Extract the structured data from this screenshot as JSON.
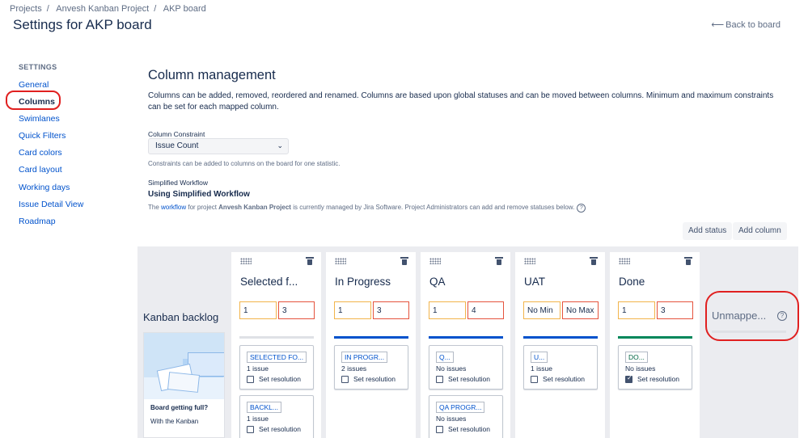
{
  "breadcrumbs": [
    "Projects",
    "Anvesh Kanban Project",
    "AKP board"
  ],
  "page_title": "Settings for AKP board",
  "back_link": "Back to board",
  "sidebar": {
    "heading": "SETTINGS",
    "items": [
      {
        "label": "General"
      },
      {
        "label": "Columns",
        "active": true
      },
      {
        "label": "Swimlanes"
      },
      {
        "label": "Quick Filters"
      },
      {
        "label": "Card colors"
      },
      {
        "label": "Card layout"
      },
      {
        "label": "Working days"
      },
      {
        "label": "Issue Detail View"
      },
      {
        "label": "Roadmap"
      }
    ]
  },
  "main": {
    "title": "Column management",
    "description": "Columns can be added, removed, reordered and renamed. Columns are based upon global statuses and can be moved between columns. Minimum and maximum constraints can be set for each mapped column.",
    "constraint_label": "Column Constraint",
    "constraint_value": "Issue Count",
    "constraint_hint": "Constraints can be added to columns on the board for one statistic.",
    "workflow_label": "Simplified Workflow",
    "workflow_title": "Using Simplified Workflow",
    "workflow_desc_pre": "The ",
    "workflow_link": "workflow",
    "workflow_desc_mid": " for project ",
    "workflow_project": "Anvesh Kanban Project",
    "workflow_desc_post": " is currently managed by Jira Software. Project Administrators can add and remove statuses below.",
    "add_status": "Add status",
    "add_column": "Add column"
  },
  "board": {
    "backlog_title": "Kanban backlog",
    "backlog_card_title": "Board getting full?",
    "backlog_card_body": "With the Kanban",
    "columns": [
      {
        "name": "Selected f...",
        "min": "1",
        "max": "3",
        "bar_color": "#dfe1e6",
        "statuses": [
          {
            "label": "SELECTED FO...",
            "count": "1 issue",
            "resolution": "Set resolution",
            "checked": false
          },
          {
            "label": "BACKL...",
            "count": "1 issue",
            "resolution": "Set resolution",
            "checked": false
          }
        ]
      },
      {
        "name": "In Progress",
        "min": "1",
        "max": "3",
        "bar_color": "#0052cc",
        "statuses": [
          {
            "label": "IN PROGR...",
            "count": "2 issues",
            "resolution": "Set resolution",
            "checked": false
          }
        ]
      },
      {
        "name": "QA",
        "min": "1",
        "max": "4",
        "bar_color": "#0052cc",
        "statuses": [
          {
            "label": "Q...",
            "count": "No issues",
            "resolution": "Set resolution",
            "checked": false
          },
          {
            "label": "QA PROGR...",
            "count": "No issues",
            "resolution": "Set resolution",
            "checked": false
          }
        ]
      },
      {
        "name": "UAT",
        "min": "No Min",
        "max": "No Max",
        "bar_color": "#0052cc",
        "statuses": [
          {
            "label": "U...",
            "count": "1 issue",
            "resolution": "Set resolution",
            "checked": false
          }
        ]
      },
      {
        "name": "Done",
        "min": "1",
        "max": "3",
        "bar_color": "#00875a",
        "statuses": [
          {
            "label": "DO...",
            "count": "No issues",
            "resolution": "Set resolution",
            "checked": true,
            "done": true
          }
        ]
      }
    ],
    "unmapped_title": "Unmappe..."
  }
}
